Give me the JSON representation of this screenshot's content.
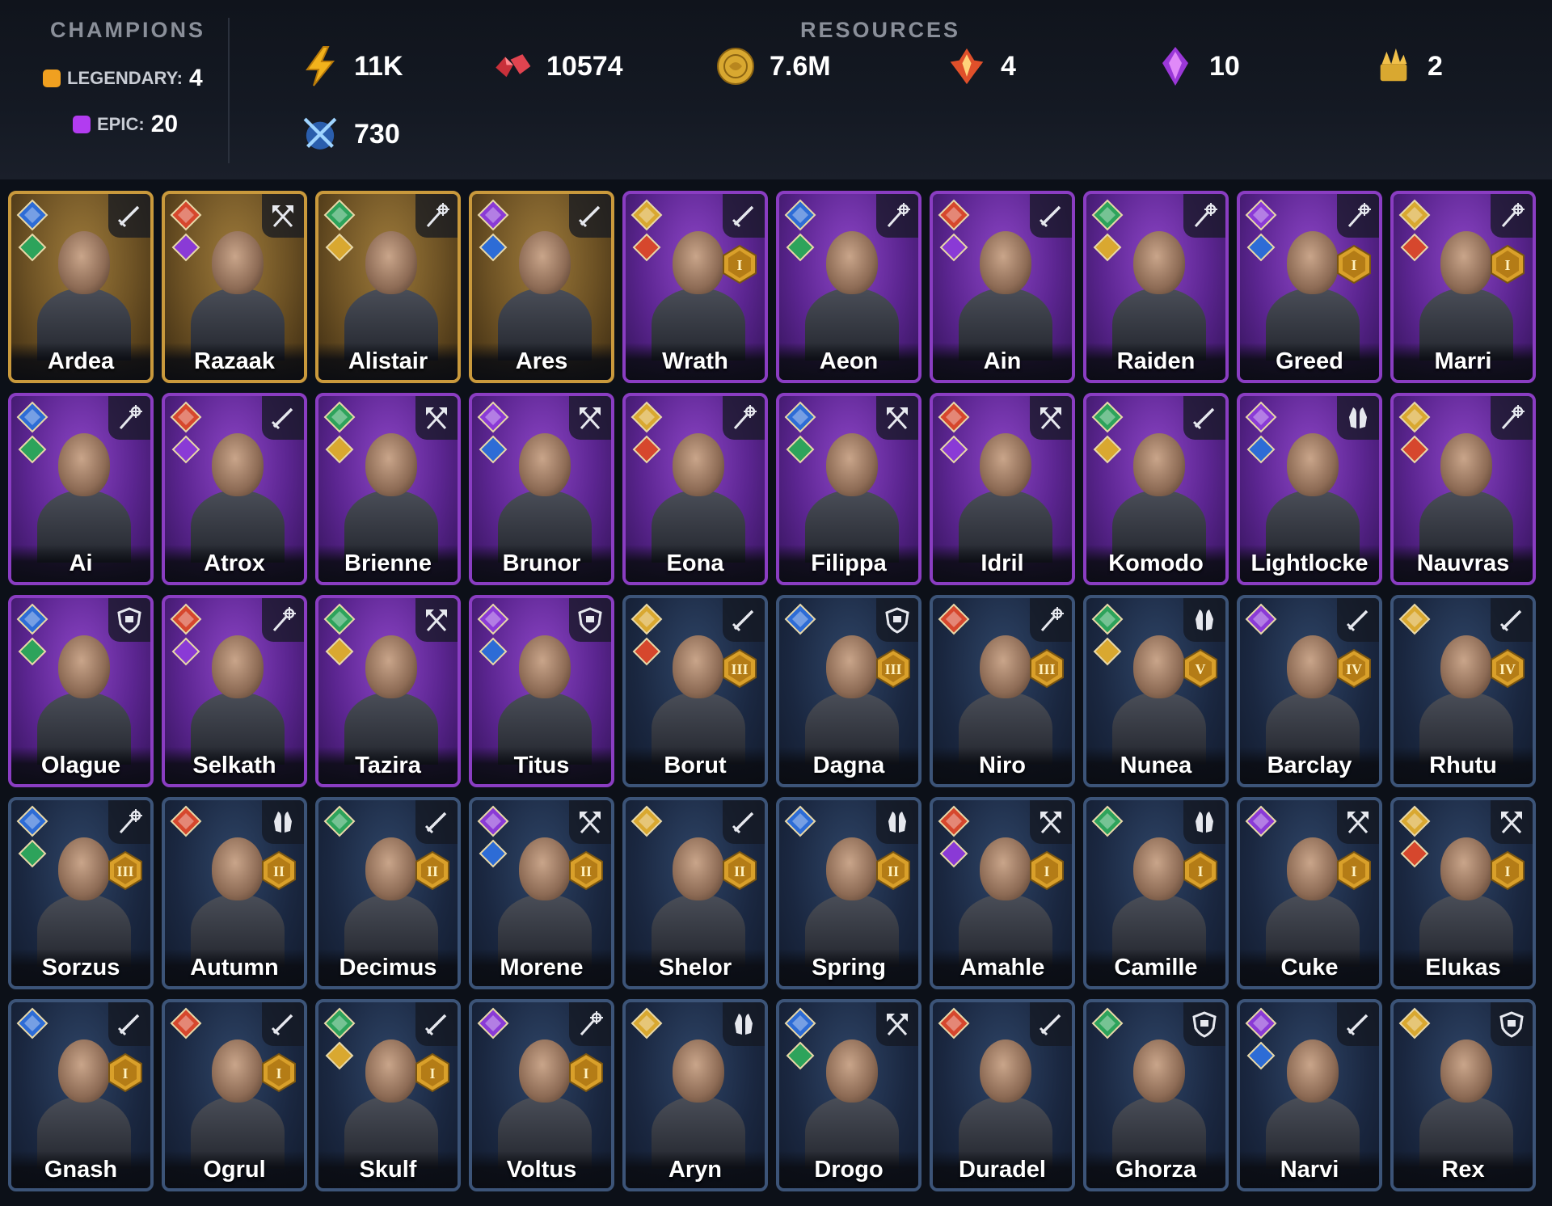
{
  "header": {
    "champions_title": "CHAMPIONS",
    "legendary_label": "LEGENDARY:",
    "legendary_count": "4",
    "legendary_color": "#f0a020",
    "epic_label": "EPIC:",
    "epic_count": "20",
    "epic_color": "#b23cf0",
    "resources_title": "RESOURCES"
  },
  "resources": [
    {
      "icon": "energy-bolt-icon",
      "value": "11K"
    },
    {
      "icon": "rubies-icon",
      "value": "10574"
    },
    {
      "icon": "gold-coin-icon",
      "value": "7.6M"
    },
    {
      "icon": "fire-shard-icon",
      "value": "4"
    },
    {
      "icon": "purple-crystal-icon",
      "value": "10"
    },
    {
      "icon": "gold-trophy-icon",
      "value": "2"
    },
    {
      "icon": "crossed-swords-icon",
      "value": "730"
    }
  ],
  "champions": [
    {
      "name": "Ardea",
      "rarity": "legendary",
      "role": "sword"
    },
    {
      "name": "Razaak",
      "rarity": "legendary",
      "role": "axe"
    },
    {
      "name": "Alistair",
      "rarity": "legendary",
      "role": "staff"
    },
    {
      "name": "Ares",
      "rarity": "legendary",
      "role": "sword"
    },
    {
      "name": "Wrath",
      "rarity": "epic",
      "role": "sword",
      "rank": "I"
    },
    {
      "name": "Aeon",
      "rarity": "epic",
      "role": "staff"
    },
    {
      "name": "Ain",
      "rarity": "epic",
      "role": "sword"
    },
    {
      "name": "Raiden",
      "rarity": "epic",
      "role": "staff"
    },
    {
      "name": "Greed",
      "rarity": "epic",
      "role": "staff",
      "rank": "I"
    },
    {
      "name": "Marri",
      "rarity": "epic",
      "role": "staff",
      "rank": "I"
    },
    {
      "name": "Ai",
      "rarity": "epic",
      "role": "staff"
    },
    {
      "name": "Atrox",
      "rarity": "epic",
      "role": "sword"
    },
    {
      "name": "Brienne",
      "rarity": "epic",
      "role": "axe"
    },
    {
      "name": "Brunor",
      "rarity": "epic",
      "role": "axe"
    },
    {
      "name": "Eona",
      "rarity": "epic",
      "role": "staff"
    },
    {
      "name": "Filippa",
      "rarity": "epic",
      "role": "axe"
    },
    {
      "name": "Idril",
      "rarity": "epic",
      "role": "axe"
    },
    {
      "name": "Komodo",
      "rarity": "epic",
      "role": "sword"
    },
    {
      "name": "Lightlocke",
      "rarity": "epic",
      "role": "hands"
    },
    {
      "name": "Nauvras",
      "rarity": "epic",
      "role": "staff"
    },
    {
      "name": "Olague",
      "rarity": "epic",
      "role": "shield"
    },
    {
      "name": "Selkath",
      "rarity": "epic",
      "role": "staff"
    },
    {
      "name": "Tazira",
      "rarity": "epic",
      "role": "axe"
    },
    {
      "name": "Titus",
      "rarity": "epic",
      "role": "shield"
    },
    {
      "name": "Borut",
      "rarity": "rare",
      "role": "sword",
      "rank": "III"
    },
    {
      "name": "Dagna",
      "rarity": "rare",
      "role": "shield",
      "rank": "III"
    },
    {
      "name": "Niro",
      "rarity": "rare",
      "role": "staff",
      "rank": "III"
    },
    {
      "name": "Nunea",
      "rarity": "rare",
      "role": "hands",
      "rank": "V"
    },
    {
      "name": "Barclay",
      "rarity": "rare",
      "role": "sword",
      "rank": "IV"
    },
    {
      "name": "Rhutu",
      "rarity": "rare",
      "role": "sword",
      "rank": "IV"
    },
    {
      "name": "Sorzus",
      "rarity": "rare",
      "role": "staff",
      "rank": "III"
    },
    {
      "name": "Autumn",
      "rarity": "rare",
      "role": "hands",
      "rank": "II"
    },
    {
      "name": "Decimus",
      "rarity": "rare",
      "role": "sword",
      "rank": "II"
    },
    {
      "name": "Morene",
      "rarity": "rare",
      "role": "axe",
      "rank": "II"
    },
    {
      "name": "Shelor",
      "rarity": "rare",
      "role": "sword",
      "rank": "II"
    },
    {
      "name": "Spring",
      "rarity": "rare",
      "role": "hands",
      "rank": "II"
    },
    {
      "name": "Amahle",
      "rarity": "rare",
      "role": "axe",
      "rank": "I"
    },
    {
      "name": "Camille",
      "rarity": "rare",
      "role": "hands",
      "rank": "I"
    },
    {
      "name": "Cuke",
      "rarity": "rare",
      "role": "axe",
      "rank": "I"
    },
    {
      "name": "Elukas",
      "rarity": "rare",
      "role": "axe",
      "rank": "I"
    },
    {
      "name": "Gnash",
      "rarity": "rare",
      "role": "sword",
      "rank": "I"
    },
    {
      "name": "Ogrul",
      "rarity": "rare",
      "role": "sword",
      "rank": "I"
    },
    {
      "name": "Skulf",
      "rarity": "rare",
      "role": "sword",
      "rank": "I"
    },
    {
      "name": "Voltus",
      "rarity": "rare",
      "role": "staff",
      "rank": "I"
    },
    {
      "name": "Aryn",
      "rarity": "rare",
      "role": "hands"
    },
    {
      "name": "Drogo",
      "rarity": "rare",
      "role": "axe"
    },
    {
      "name": "Duradel",
      "rarity": "rare",
      "role": "sword"
    },
    {
      "name": "Ghorza",
      "rarity": "rare",
      "role": "shield"
    },
    {
      "name": "Narvi",
      "rarity": "rare",
      "role": "sword"
    },
    {
      "name": "Rex",
      "rarity": "rare",
      "role": "shield"
    }
  ]
}
